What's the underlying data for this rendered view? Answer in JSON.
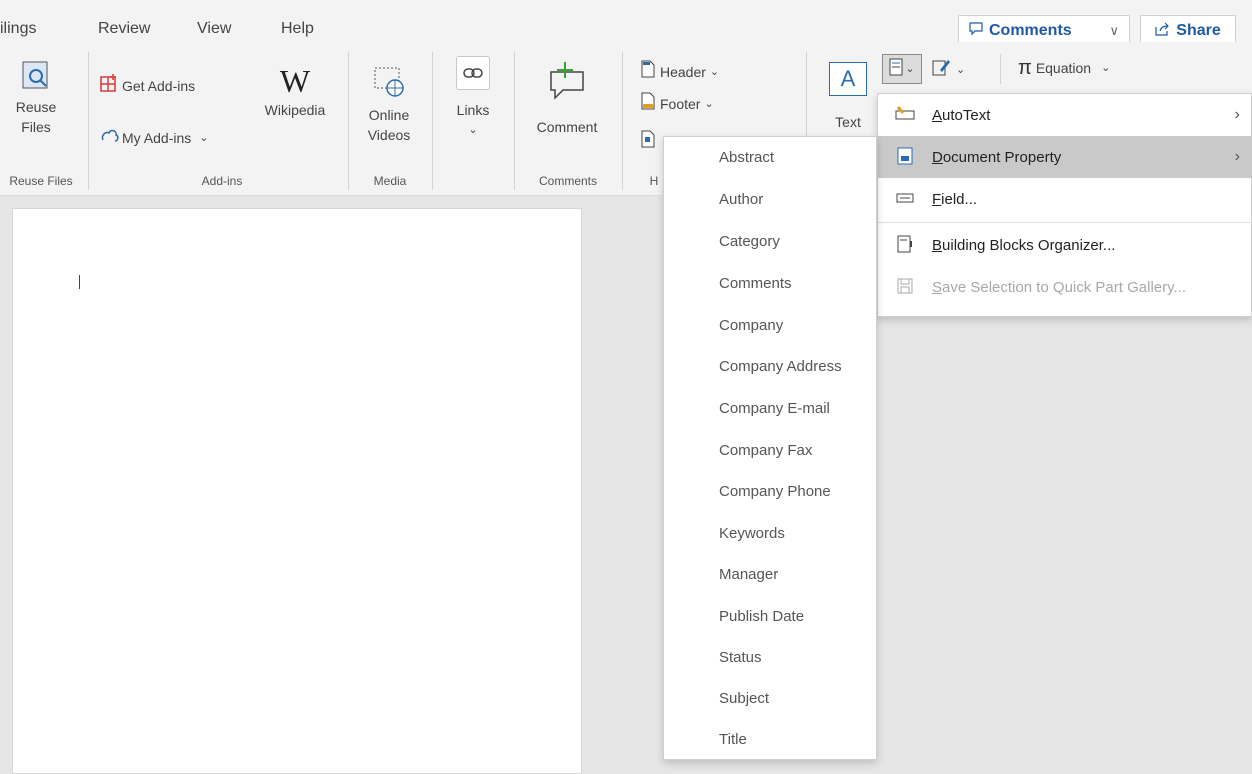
{
  "tabs": [
    "ilings",
    "Review",
    "View",
    "Help"
  ],
  "header_buttons": {
    "comments_label": "Comments",
    "share_label": "Share"
  },
  "ribbon": {
    "reuse_files": {
      "label_line1": "Reuse",
      "label_line2": "Files",
      "group": "Reuse Files"
    },
    "addins": {
      "get_addins": "Get Add-ins",
      "my_addins": "My Add-ins",
      "wikipedia": "Wikipedia",
      "group": "Add-ins"
    },
    "media": {
      "online_videos_1": "Online",
      "online_videos_2": "Videos",
      "group": "Media"
    },
    "links": {
      "label": "Links"
    },
    "comments": {
      "comment": "Comment",
      "group": "Comments"
    },
    "header_footer": {
      "header": "Header",
      "footer": "Footer",
      "group_partial": "H"
    },
    "text": {
      "label": "Text",
      "box_letter": "A"
    },
    "equation": {
      "label": "Equation",
      "symbol": "π"
    }
  },
  "quick_parts_menu": {
    "items": [
      {
        "label": "AutoText",
        "underline": "A",
        "rest": "utoText",
        "has_submenu": true,
        "highlighted": false,
        "disabled": false
      },
      {
        "label": "Document Property",
        "underline": "D",
        "rest": "ocument Property",
        "has_submenu": true,
        "highlighted": true,
        "disabled": false
      },
      {
        "label": "Field...",
        "underline": "F",
        "rest": "ield...",
        "has_submenu": false,
        "highlighted": false,
        "disabled": false
      },
      {
        "label": "Building Blocks Organizer...",
        "underline": "B",
        "rest": "uilding Blocks Organizer...",
        "has_submenu": false,
        "highlighted": false,
        "disabled": false
      },
      {
        "label": "Save Selection to Quick Part Gallery...",
        "underline": "S",
        "rest": "ave Selection to Quick Part Gallery...",
        "has_submenu": false,
        "highlighted": false,
        "disabled": true
      }
    ]
  },
  "document_property_menu": {
    "items": [
      "Abstract",
      "Author",
      "Category",
      "Comments",
      "Company",
      "Company Address",
      "Company E-mail",
      "Company Fax",
      "Company Phone",
      "Keywords",
      "Manager",
      "Publish Date",
      "Status",
      "Subject",
      "Title"
    ]
  },
  "colors": {
    "accent": "#1e5aa6",
    "ribbon_bg": "#f3f3f3",
    "highlight": "#c9c9c9"
  }
}
